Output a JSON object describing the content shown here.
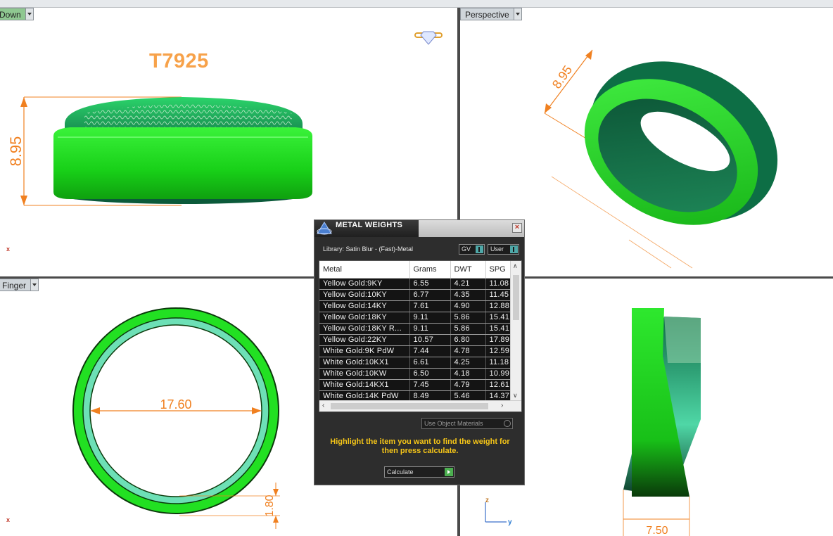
{
  "viewports": {
    "top_left": {
      "label": "Down",
      "model_code": "T7925",
      "dimension": "8.95"
    },
    "top_right": {
      "label": "Perspective",
      "dimension": "8.95"
    },
    "bottom_left": {
      "label": "Finger",
      "dimension_diameter": "17.60",
      "dimension_thickness": "1.80"
    },
    "bottom_right": {
      "dimension_width": "7.50",
      "axis_z": "z",
      "axis_y": "y"
    },
    "axis_marker": "x"
  },
  "dialog": {
    "title": "METAL WEIGHTS",
    "library": "Library: Satin Blur - (Fast)-Metal",
    "toggle_gv": "GV",
    "toggle_user": "User",
    "columns": [
      "Metal",
      "Grams",
      "DWT",
      "SPG"
    ],
    "rows": [
      [
        "Yellow Gold:9KY",
        "6.55",
        "4.21",
        "11.08"
      ],
      [
        "Yellow Gold:10KY",
        "6.77",
        "4.35",
        "11.45"
      ],
      [
        "Yellow Gold:14KY",
        "7.61",
        "4.90",
        "12.88"
      ],
      [
        "Yellow Gold:18KY",
        "9.11",
        "5.86",
        "15.41"
      ],
      [
        "Yellow Gold:18KY R...",
        "9.11",
        "5.86",
        "15.41"
      ],
      [
        "Yellow Gold:22KY",
        "10.57",
        "6.80",
        "17.89"
      ],
      [
        "White Gold:9K PdW",
        "7.44",
        "4.78",
        "12.59"
      ],
      [
        "White Gold:10KX1",
        "6.61",
        "4.25",
        "11.18"
      ],
      [
        "White Gold:10KW",
        "6.50",
        "4.18",
        "10.99"
      ],
      [
        "White Gold:14KX1",
        "7.45",
        "4.79",
        "12.61"
      ],
      [
        "White Gold:14K PdW",
        "8.49",
        "5.46",
        "14.37"
      ]
    ],
    "use_object_materials": "Use Object Materials",
    "help_text": "Highlight the item you want to find the weight for then press calculate.",
    "calculate_label": "Calculate"
  },
  "colors": {
    "ring_green": "#22dd22",
    "ring_dark": "#0d5c3a",
    "inner_teal": "#62e0b4",
    "dimension_orange": "#f08020",
    "title_orange": "#f7a24a",
    "help_yellow": "#f5c518"
  }
}
